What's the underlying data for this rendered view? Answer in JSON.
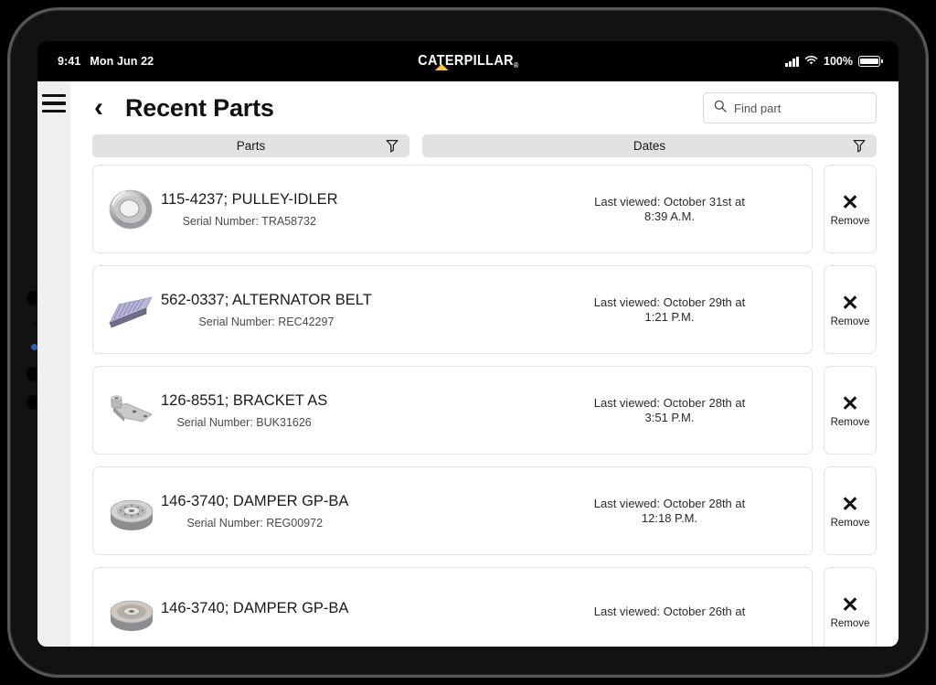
{
  "statusbar": {
    "time": "9:41",
    "date": "Mon Jun 22",
    "brand": "CATERPILLAR",
    "brand_mark": "®",
    "battery_percent": "100%",
    "signal_icon": "cellular-signal-icon",
    "wifi_icon": "wifi-icon",
    "battery_icon": "battery-full-icon"
  },
  "nav": {
    "menu_icon": "hamburger-menu-icon",
    "back_icon": "chevron-left-icon",
    "title": "Recent Parts"
  },
  "search": {
    "placeholder": "Find part",
    "value": "",
    "icon": "search-icon"
  },
  "filters": [
    {
      "label": "Parts",
      "icon": "filter-funnel-icon"
    },
    {
      "label": "Dates",
      "icon": "filter-funnel-icon"
    }
  ],
  "remove": {
    "glyph": "✕",
    "label": "Remove",
    "icon": "close-x-icon"
  },
  "rows": [
    {
      "part": "115-4237; PULLEY-IDLER",
      "serial": "Serial Number: TRA58732",
      "date_line1": "Last viewed: October 31st at",
      "date_line2": "8:39 A.M.",
      "thumb": "pulley-idler-thumbnail"
    },
    {
      "part": "562-0337; ALTERNATOR BELT",
      "serial": "Serial Number: REC42297",
      "date_line1": "Last viewed: October 29th at",
      "date_line2": "1:21 P.M.",
      "thumb": "alternator-belt-thumbnail"
    },
    {
      "part": "126-8551; BRACKET AS",
      "serial": "Serial Number: BUK31626",
      "date_line1": "Last viewed: October 28th at",
      "date_line2": "3:51 P.M.",
      "thumb": "bracket-as-thumbnail"
    },
    {
      "part": "146-3740; DAMPER GP-BA",
      "serial": "Serial Number: REG00972",
      "date_line1": "Last viewed: October 28th at",
      "date_line2": "12:18 P.M.",
      "thumb": "damper-gp-ba-thumbnail"
    },
    {
      "part": "146-3740; DAMPER GP-BA",
      "serial": "",
      "date_line1": "Last viewed: October 26th at",
      "date_line2": "",
      "thumb": "damper-gp-ba-thumbnail"
    }
  ],
  "colors": {
    "brand_yellow": "#FFC425",
    "rail": "#efefef",
    "pill": "#e2e2e2",
    "card_border": "#e3e3e3"
  }
}
